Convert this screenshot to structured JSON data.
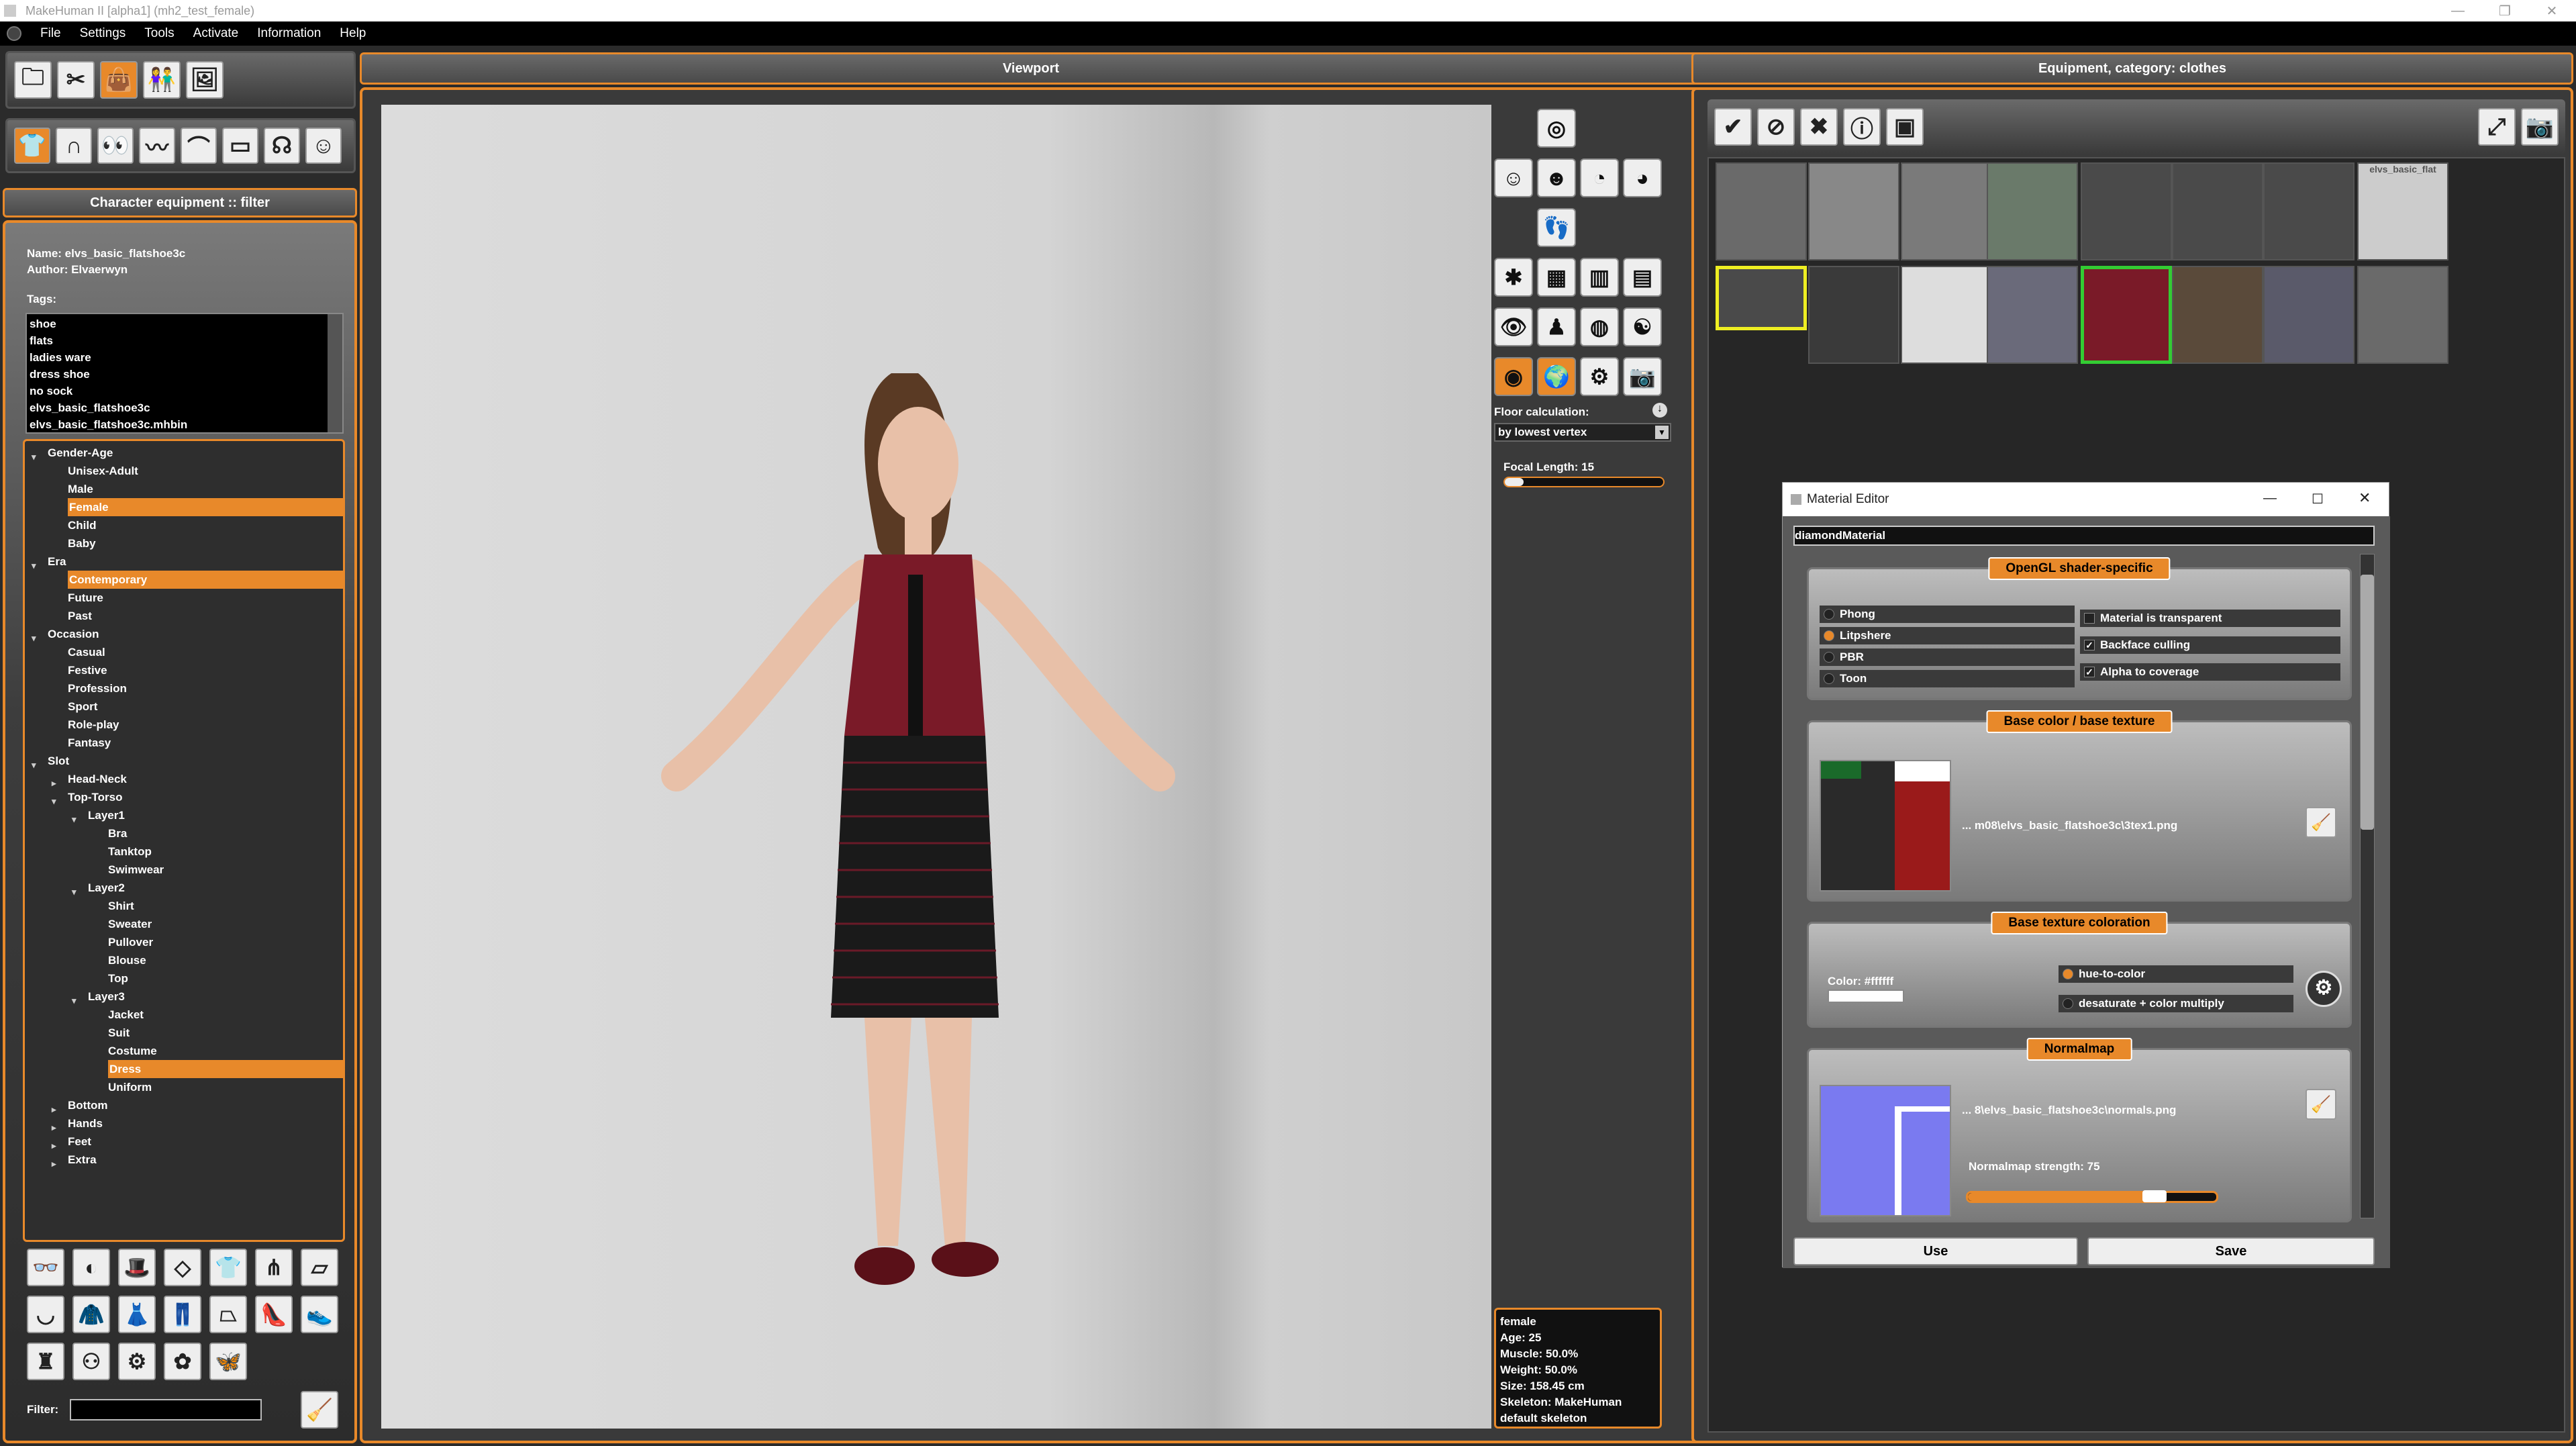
{
  "window": {
    "title": "MakeHuman II [alpha1]  (mh2_test_female)",
    "controls": [
      "—",
      "❐",
      "✕"
    ]
  },
  "menu": [
    "File",
    "Settings",
    "Tools",
    "Activate",
    "Information",
    "Help"
  ],
  "left": {
    "filter_header": "Character equipment :: filter",
    "name_line": "Name: elvs_basic_flatshoe3c",
    "author_line": "Author: Elvaerwyn",
    "tags_label": "Tags:",
    "tags": [
      "shoe",
      "flats",
      "ladies ware",
      "dress shoe",
      "no sock",
      "elvs_basic_flatshoe3c",
      "elvs_basic_flatshoe3c.mhbin"
    ],
    "tree": [
      {
        "label": "Gender-Age",
        "level": 0,
        "arrow": "open"
      },
      {
        "label": "Unisex-Adult",
        "level": 1
      },
      {
        "label": "Male",
        "level": 1
      },
      {
        "label": "Female",
        "level": 1,
        "selected": true
      },
      {
        "label": "Child",
        "level": 1
      },
      {
        "label": "Baby",
        "level": 1
      },
      {
        "label": "Era",
        "level": 0,
        "arrow": "open"
      },
      {
        "label": "Contemporary",
        "level": 1,
        "selected": true
      },
      {
        "label": "Future",
        "level": 1
      },
      {
        "label": "Past",
        "level": 1
      },
      {
        "label": "Occasion",
        "level": 0,
        "arrow": "open"
      },
      {
        "label": "Casual",
        "level": 1
      },
      {
        "label": "Festive",
        "level": 1
      },
      {
        "label": "Profession",
        "level": 1
      },
      {
        "label": "Sport",
        "level": 1
      },
      {
        "label": "Role-play",
        "level": 1
      },
      {
        "label": "Fantasy",
        "level": 1
      },
      {
        "label": "Slot",
        "level": 0,
        "arrow": "open"
      },
      {
        "label": "Head-Neck",
        "level": 1,
        "arrow": "closed"
      },
      {
        "label": "Top-Torso",
        "level": 1,
        "arrow": "open"
      },
      {
        "label": "Layer1",
        "level": 2,
        "arrow": "open"
      },
      {
        "label": "Bra",
        "level": 3
      },
      {
        "label": "Tanktop",
        "level": 3
      },
      {
        "label": "Swimwear",
        "level": 3
      },
      {
        "label": "Layer2",
        "level": 2,
        "arrow": "open"
      },
      {
        "label": "Shirt",
        "level": 3
      },
      {
        "label": "Sweater",
        "level": 3
      },
      {
        "label": "Pullover",
        "level": 3
      },
      {
        "label": "Blouse",
        "level": 3
      },
      {
        "label": "Top",
        "level": 3
      },
      {
        "label": "Layer3",
        "level": 2,
        "arrow": "open"
      },
      {
        "label": "Jacket",
        "level": 3
      },
      {
        "label": "Suit",
        "level": 3
      },
      {
        "label": "Costume",
        "level": 3
      },
      {
        "label": "Dress",
        "level": 3,
        "selected": true
      },
      {
        "label": "Uniform",
        "level": 3
      },
      {
        "label": "Bottom",
        "level": 1,
        "arrow": "closed"
      },
      {
        "label": "Hands",
        "level": 1,
        "arrow": "closed"
      },
      {
        "label": "Feet",
        "level": 1,
        "arrow": "closed"
      },
      {
        "label": "Extra",
        "level": 1,
        "arrow": "closed"
      }
    ],
    "filter_label": "Filter:",
    "filter_value": ""
  },
  "viewport": {
    "header": "Viewport",
    "floor_label": "Floor calculation:",
    "floor_value": "by lowest vertex",
    "focal_label": "Focal Length: 15",
    "focal_fraction": 0.12,
    "info": [
      "female",
      "Age: 25",
      "Muscle: 50.0%",
      "Weight: 50.0%",
      "Size: 158.45 cm",
      "Skeleton: MakeHuman",
      "default skeleton"
    ]
  },
  "equipment": {
    "header": "Equipment, category: clothes",
    "thumb_label_hanger": "elvs_basic_flat"
  },
  "material_editor": {
    "title": "Material Editor",
    "name_value": "diamondMaterial",
    "shader_group": "OpenGL shader-specific",
    "shaders": [
      {
        "label": "Phong",
        "on": false
      },
      {
        "label": "Litpshere",
        "on": true
      },
      {
        "label": "PBR",
        "on": false
      },
      {
        "label": "Toon",
        "on": false
      }
    ],
    "checks": [
      {
        "label": "Material is transparent",
        "on": false
      },
      {
        "label": "Backface culling",
        "on": true
      },
      {
        "label": "Alpha to coverage",
        "on": true
      }
    ],
    "base_group": "Base color / base texture",
    "base_path": "... m08\\elvs_basic_flatshoe3c\\3tex1.png",
    "coloration_group": "Base texture coloration",
    "color_label": "Color: #ffffff",
    "color_hex": "#ffffff",
    "coloration_options": [
      {
        "label": "hue-to-color",
        "on": true
      },
      {
        "label": "desaturate + color multiply",
        "on": false
      }
    ],
    "normal_group": "Normalmap",
    "normal_path": "... 8\\elvs_basic_flatshoe3c\\normals.png",
    "normal_strength_label": "Normalmap strength: 75",
    "normal_strength_fraction": 0.75,
    "use_label": "Use",
    "save_label": "Save"
  },
  "colors": {
    "accent": "#e8892a",
    "selected_green": "#33cc33",
    "selected_yellow": "#eeee22"
  }
}
